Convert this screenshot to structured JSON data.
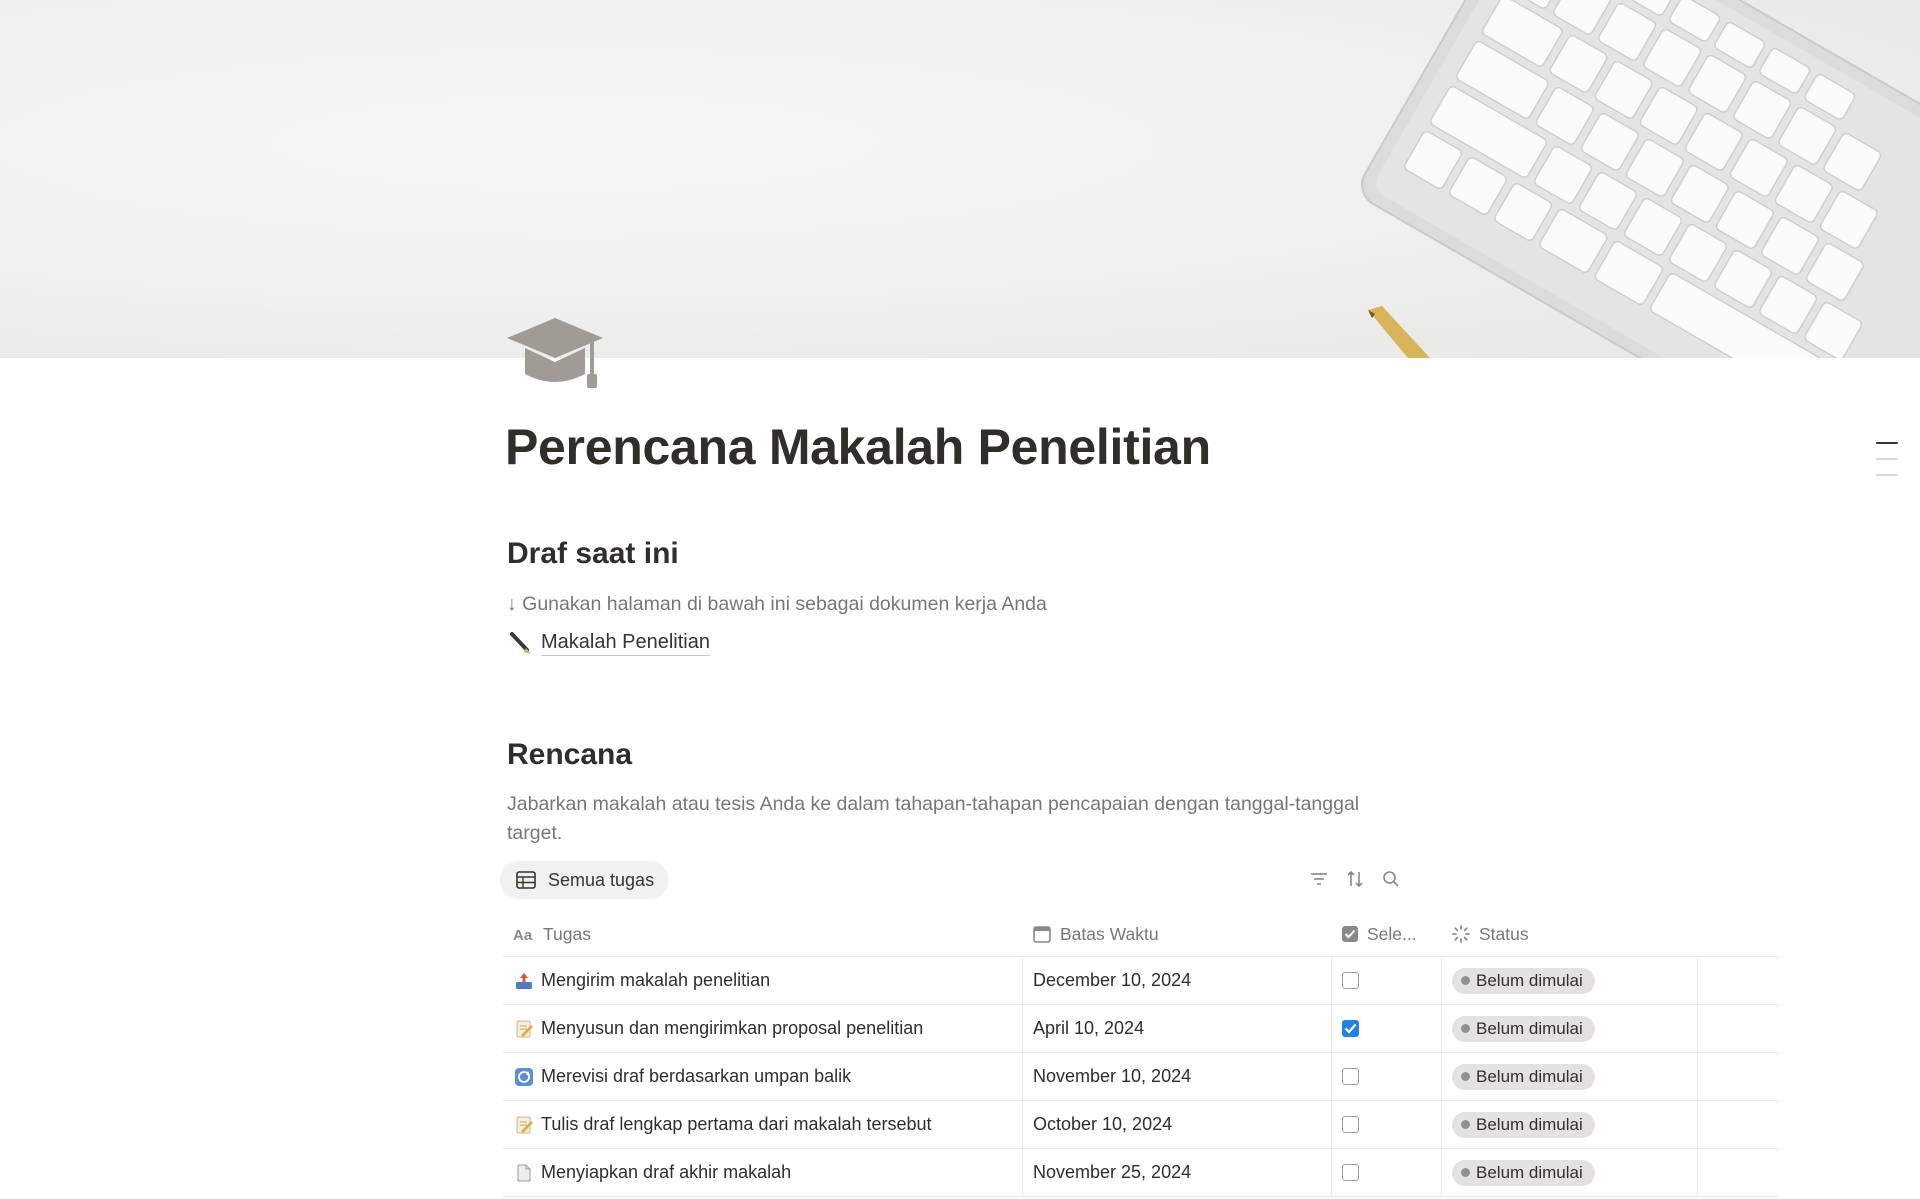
{
  "page": {
    "title": "Perencana Makalah Penelitian",
    "icon": "graduation-cap-icon"
  },
  "draft_section": {
    "heading": "Draf saat ini",
    "hint": "↓ Gunakan halaman di bawah ini sebagai dokumen kerja Anda",
    "link_label": "Makalah Penelitian",
    "link_icon": "pen-icon"
  },
  "plan_section": {
    "heading": "Rencana",
    "description": "Jabarkan makalah atau tesis Anda ke dalam tahapan-tahapan pencapaian dengan tanggal-tanggal target."
  },
  "database": {
    "view_tab": "Semua tugas",
    "columns": {
      "task": "Tugas",
      "deadline": "Batas Waktu",
      "done": "Sele...",
      "status": "Status"
    },
    "rows": [
      {
        "icon": "outbox-tray-icon",
        "task": "Mengirim makalah penelitian",
        "deadline": "December 10, 2024",
        "done": false,
        "status": "Belum dimulai"
      },
      {
        "icon": "memo-icon",
        "task": "Menyusun dan mengirimkan proposal penelitian",
        "deadline": "April 10, 2024",
        "done": true,
        "status": "Belum dimulai"
      },
      {
        "icon": "arrows-cycle-icon",
        "task": "Merevisi draf berdasarkan umpan balik",
        "deadline": "November 10, 2024",
        "done": false,
        "status": "Belum dimulai"
      },
      {
        "icon": "memo-icon",
        "task": "Tulis draf lengkap pertama dari makalah tersebut",
        "deadline": "October 10, 2024",
        "done": false,
        "status": "Belum dimulai"
      },
      {
        "icon": "page-icon",
        "task": "Menyiapkan draf akhir makalah",
        "deadline": "November 25, 2024",
        "done": false,
        "status": "Belum dimulai"
      }
    ]
  },
  "colors": {
    "accent_checkbox": "#2383e2",
    "status_pill_bg": "#e3e2e0",
    "text": "#37352f",
    "muted": "#787774"
  }
}
